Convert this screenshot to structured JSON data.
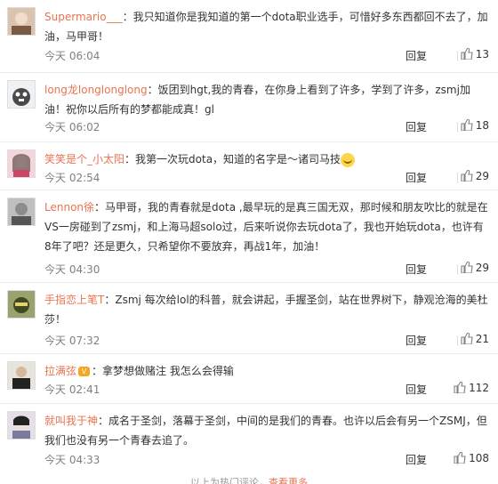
{
  "reply_label": "回复",
  "comments": [
    {
      "user": "Supermario___",
      "sep": "：",
      "text": "我只知道你是我知道的第一个dota职业选手，可惜好多东西都回不去了，加油，马甲哥！",
      "time": "今天 06:04",
      "likes": "13"
    },
    {
      "user": "long龙longlonglong",
      "sep": "：",
      "text": "饭团到hgt,我的青春，在你身上看到了许多，学到了许多，zsmj加油！祝你以后所有的梦都能成真！gl",
      "time": "今天 06:02",
      "likes": "18"
    },
    {
      "user": "笑笑是个_小太阳",
      "sep": "：",
      "text": "我第一次玩dota，知道的名字是～诸司马技",
      "time": "今天 02:54",
      "likes": "29"
    },
    {
      "user": "Lennon徐",
      "sep": "：",
      "text": "马甲哥，我的青春就是dota ,最早玩的是真三国无双，那时候和朋友吹比的就是在VS一房碰到了zsmj，和上海马超solo过，后来听说你去玩dota了，我也开始玩dota，也许有8年了吧？还是更久，只希望你不要放弃，再战1年，加油！",
      "time": "今天 04:30",
      "likes": "29"
    },
    {
      "user": "手指恋上笔T",
      "sep": "：",
      "text": "Zsmj 每次给lol的科普，就会讲起，手握圣剑，站在世界树下，静观沧海的美杜莎！",
      "time": "今天 07:32",
      "likes": "21"
    },
    {
      "user": "拉满弦",
      "sep": "：",
      "text": "拿梦想做赌注 我怎么会得输",
      "time": "今天 02:41",
      "likes": "112"
    },
    {
      "user": "就叫我于神",
      "sep": "：",
      "text": "成名于圣剑，落幕于圣剑，中间的是我们的青春。也许以后会有另一个ZSMJ，但我们也没有另一个青春去追了。",
      "time": "今天 04:33",
      "likes": "108"
    }
  ],
  "footer": {
    "text": "以上为热门评论，",
    "link": "查看更多"
  },
  "icons": {
    "like": "thumbs-up-icon",
    "vip": "vip-badge-icon",
    "emoji": "emoji-icon"
  },
  "colors": {
    "username": "#eb7350",
    "meta": "#808080"
  }
}
